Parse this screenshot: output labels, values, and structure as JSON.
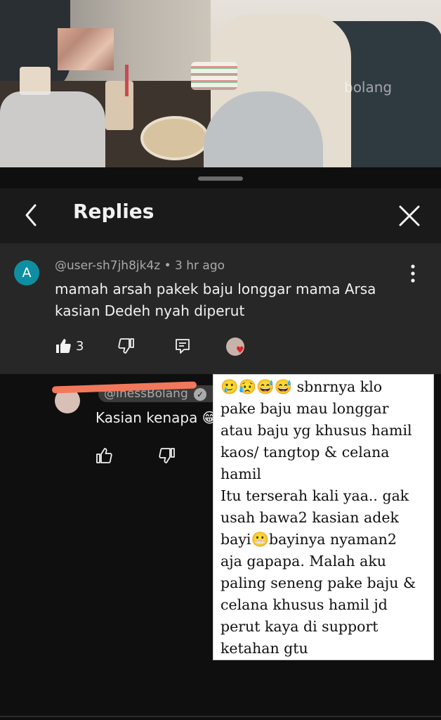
{
  "video": {
    "watermark": "bolang"
  },
  "header": {
    "title": "Replies",
    "back_icon": "chevron-left-icon",
    "close_icon": "close-icon"
  },
  "comment": {
    "avatar_letter": "A",
    "avatar_color": "#0e8fa1",
    "meta": "@user-sh7jh8jk4z • 3 hr ago",
    "text_line1": "mamah arsah pakek baju longgar mama Arsa",
    "text_line2": "kasian Dedeh nyah diperut",
    "like_count": "3"
  },
  "reply": {
    "author": "@InessBolang",
    "text": "Kasian kenapa 😁"
  },
  "note": {
    "text": "🥲😥😅😅  sbnrnya klo\npake baju mau longgar\natau baju yg khusus hamil\nkaos/ tangtop & celana\nhamil\nItu terserah kali yaa.. gak\nusah bawa2 kasian adek\nbayi😬bayinya nyaman2\naja gapapa. Malah aku\npaling seneng pake baju &\ncelana khusus hamil jd\nperut kaya di support\nketahan gtu"
  }
}
